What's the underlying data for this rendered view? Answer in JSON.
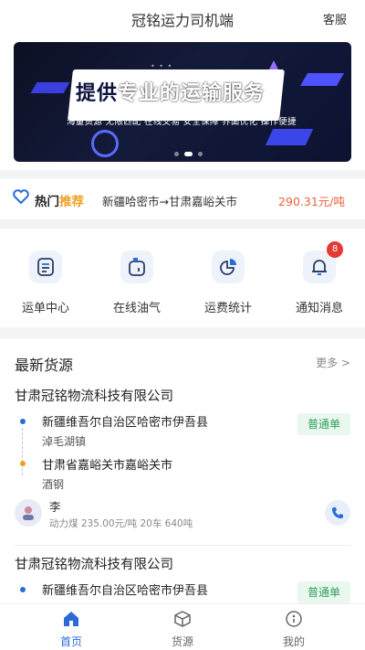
{
  "header": {
    "title": "冠铭运力司机端",
    "service_label": "客服"
  },
  "banner": {
    "headline_a": "提供",
    "headline_b": "专业的运输服务",
    "subtitle": "海量货源 无限匹配 在线交易 安全保障 界面优化 操作便捷",
    "slides": 3,
    "active_slide": 1
  },
  "hot_route": {
    "hot_label": "热门",
    "recommend_label": "推荐",
    "route": "新疆哈密市→甘肃嘉峪关市",
    "price": "290.31元/吨"
  },
  "menu": {
    "items": [
      {
        "label": "运单中心",
        "icon": "waybill-icon"
      },
      {
        "label": "在线油气",
        "icon": "fuel-icon"
      },
      {
        "label": "运费统计",
        "icon": "pie-chart-icon"
      },
      {
        "label": "通知消息",
        "icon": "bell-icon",
        "badge": "8"
      }
    ]
  },
  "goods": {
    "title": "最新货源",
    "more_label": "更多 >",
    "items": [
      {
        "company": "甘肃冠铭物流科技有限公司",
        "from_line1": "新疆维吾尔自治区哈密市伊吾县",
        "from_line2": "淖毛湖镇",
        "to_line1": "甘肃省嘉峪关市嘉峪关市",
        "to_line2": "酒钢",
        "tag": "普通单",
        "contact": "李",
        "meta": "动力煤 235.00元/吨 20车 640吨"
      },
      {
        "company": "甘肃冠铭物流科技有限公司",
        "from_line1": "新疆维吾尔自治区哈密市伊吾县",
        "tag": "普通单"
      }
    ]
  },
  "tabbar": {
    "tabs": [
      {
        "label": "首页",
        "icon": "home-icon",
        "active": true
      },
      {
        "label": "货源",
        "icon": "cube-icon",
        "active": false
      },
      {
        "label": "我的",
        "icon": "user-icon",
        "active": false
      }
    ]
  },
  "colors": {
    "accent": "#2a6bd8",
    "price": "#e8633a",
    "tag_green": "#2ea15a",
    "badge_red": "#e53935"
  }
}
